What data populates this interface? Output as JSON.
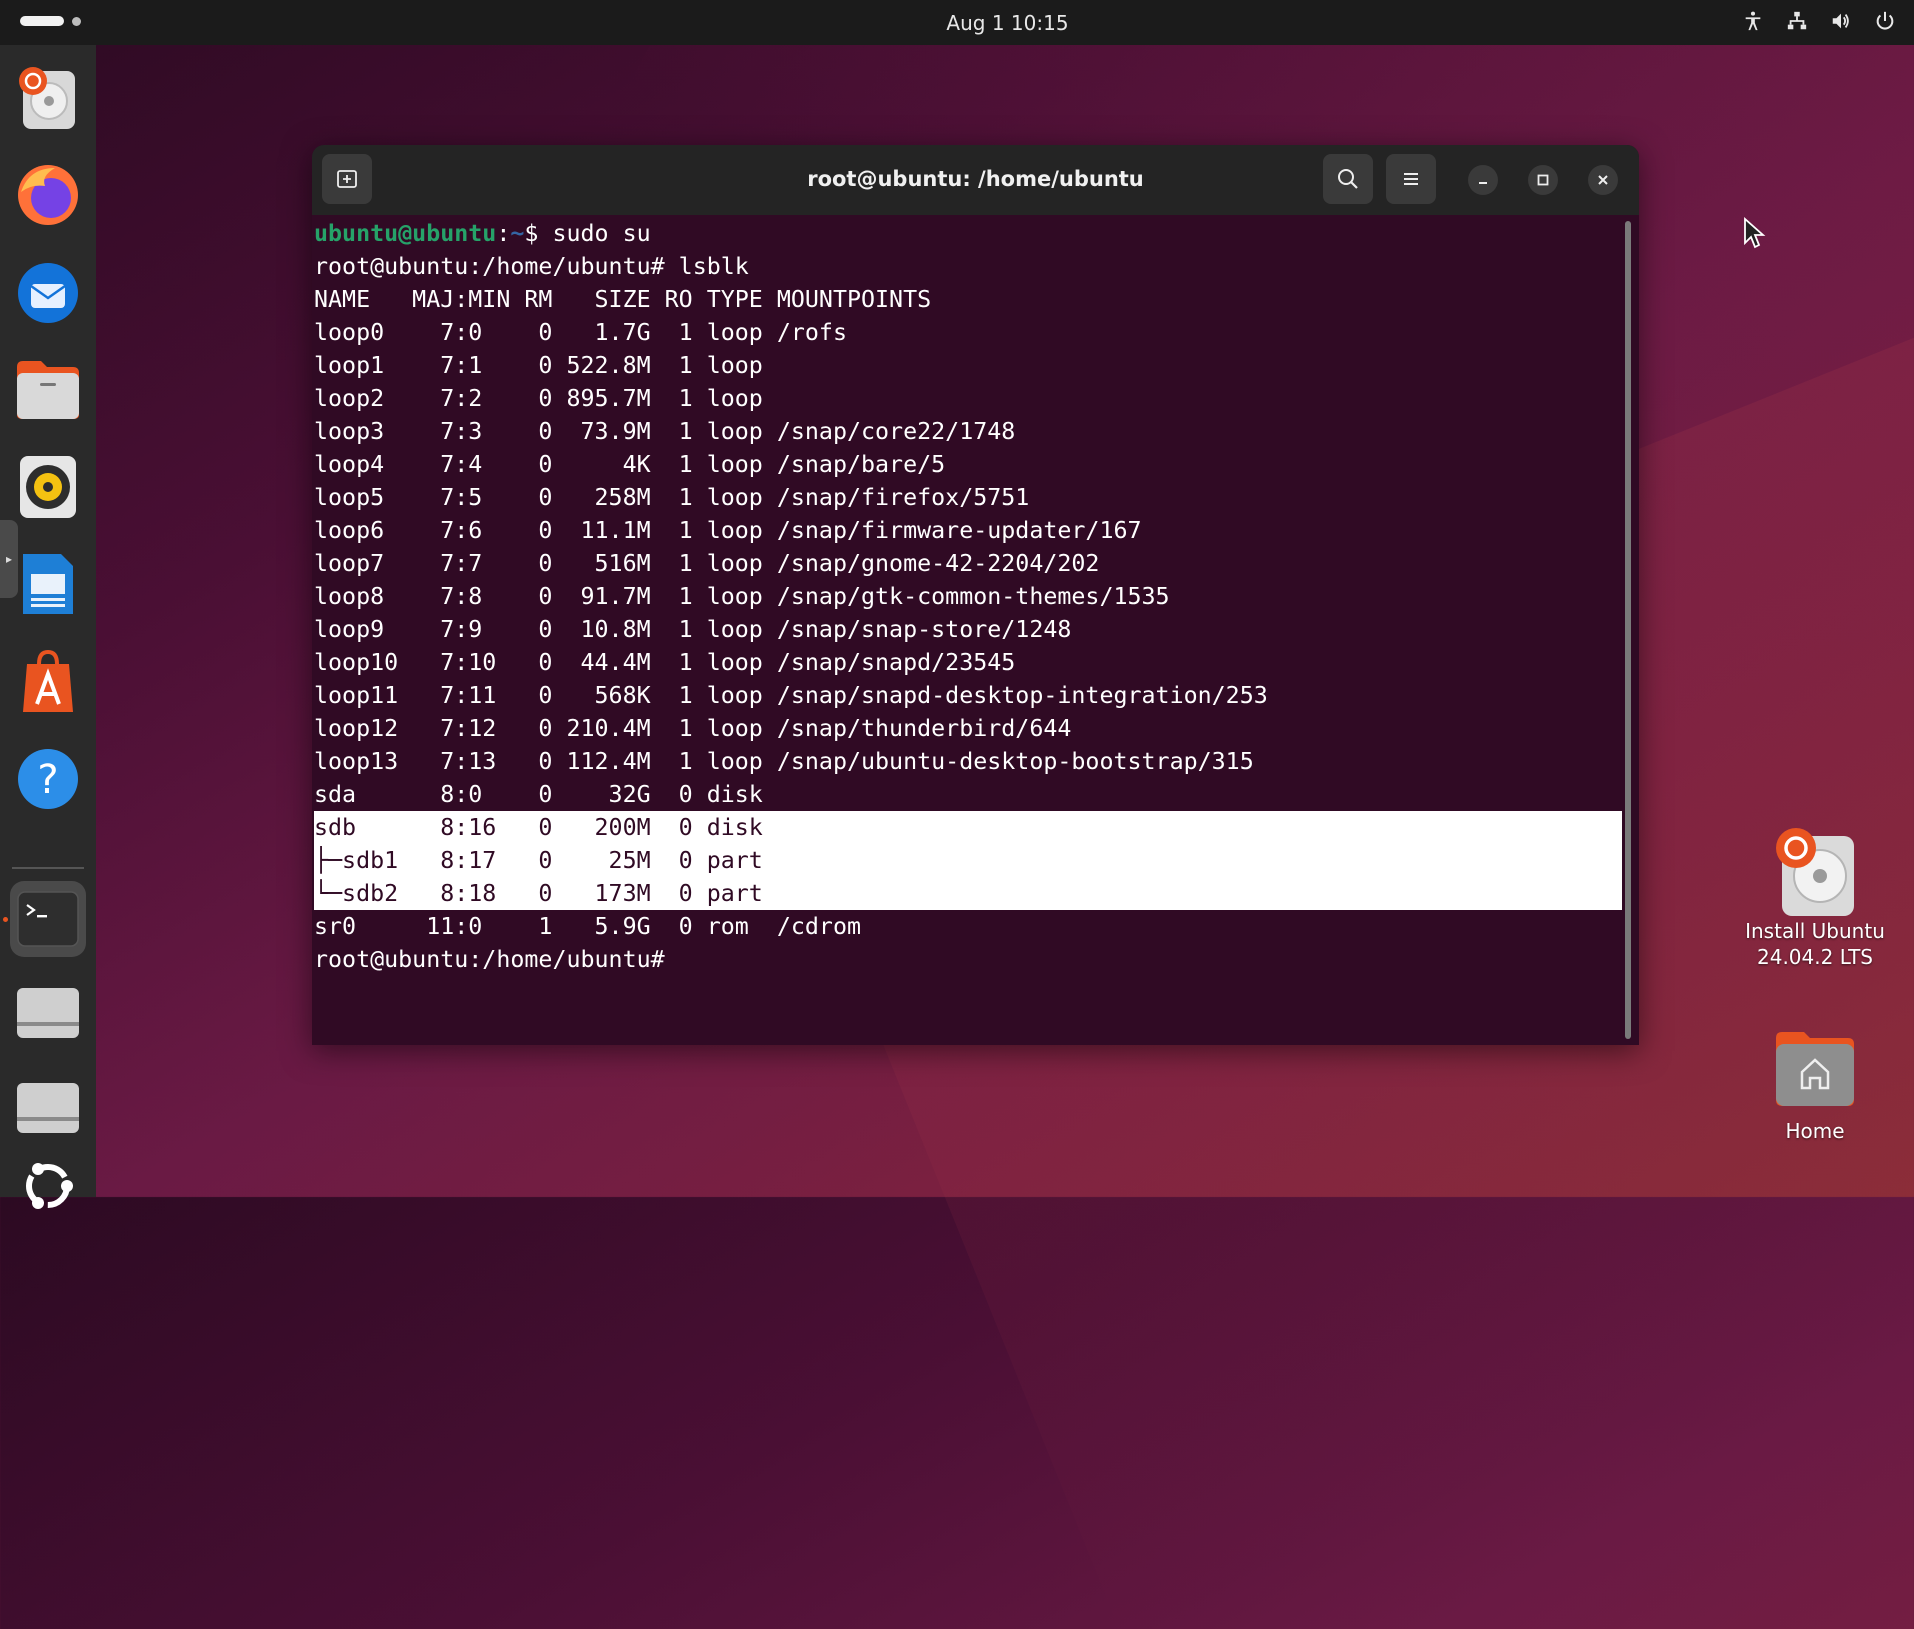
{
  "topbar": {
    "clock": "Aug 1  10:15",
    "tray_icons": [
      "accessibility-icon",
      "network-icon",
      "volume-icon",
      "power-icon"
    ]
  },
  "dock": {
    "items": [
      {
        "name": "install-ubuntu",
        "icon": "install-ubuntu-icon"
      },
      {
        "name": "firefox",
        "icon": "firefox-icon"
      },
      {
        "name": "thunderbird",
        "icon": "thunderbird-icon"
      },
      {
        "name": "files",
        "icon": "files-icon"
      },
      {
        "name": "rhythmbox",
        "icon": "rhythmbox-icon"
      },
      {
        "name": "libreoffice-writer",
        "icon": "writer-icon"
      },
      {
        "name": "app-center",
        "icon": "app-center-icon"
      },
      {
        "name": "help",
        "icon": "help-icon"
      },
      {
        "name": "terminal",
        "icon": "terminal-icon",
        "running": true
      },
      {
        "name": "drive-1",
        "icon": "drive-icon"
      },
      {
        "name": "drive-2",
        "icon": "drive-icon"
      },
      {
        "name": "show-apps",
        "icon": "ubuntu-apps-icon"
      }
    ]
  },
  "window": {
    "title": "root@ubuntu: /home/ubuntu"
  },
  "terminal": {
    "prompt_user": "ubuntu@ubuntu",
    "prompt_colon": ":",
    "prompt_path": "~",
    "prompt_dollar": "$ sudo su",
    "lines": [
      "root@ubuntu:/home/ubuntu# lsblk",
      "NAME   MAJ:MIN RM   SIZE RO TYPE MOUNTPOINTS",
      "loop0    7:0    0   1.7G  1 loop /rofs",
      "loop1    7:1    0 522.8M  1 loop",
      "loop2    7:2    0 895.7M  1 loop",
      "loop3    7:3    0  73.9M  1 loop /snap/core22/1748",
      "loop4    7:4    0     4K  1 loop /snap/bare/5",
      "loop5    7:5    0   258M  1 loop /snap/firefox/5751",
      "loop6    7:6    0  11.1M  1 loop /snap/firmware-updater/167",
      "loop7    7:7    0   516M  1 loop /snap/gnome-42-2204/202",
      "loop8    7:8    0  91.7M  1 loop /snap/gtk-common-themes/1535",
      "loop9    7:9    0  10.8M  1 loop /snap/snap-store/1248",
      "loop10   7:10   0  44.4M  1 loop /snap/snapd/23545",
      "loop11   7:11   0   568K  1 loop /snap/snapd-desktop-integration/253",
      "loop12   7:12   0 210.4M  1 loop /snap/thunderbird/644",
      "loop13   7:13   0 112.4M  1 loop /snap/ubuntu-desktop-bootstrap/315",
      "sda      8:0    0    32G  0 disk"
    ],
    "highlighted_lines": [
      "sdb      8:16   0   200M  0 disk",
      "├─sdb1   8:17   0    25M  0 part",
      "└─sdb2   8:18   0   173M  0 part"
    ],
    "tail_lines": [
      "sr0     11:0    1   5.9G  0 rom  /cdrom",
      "root@ubuntu:/home/ubuntu#"
    ]
  },
  "desktop": {
    "install_label_1": "Install Ubuntu",
    "install_label_2": "24.04.2 LTS",
    "home_label": "Home"
  }
}
